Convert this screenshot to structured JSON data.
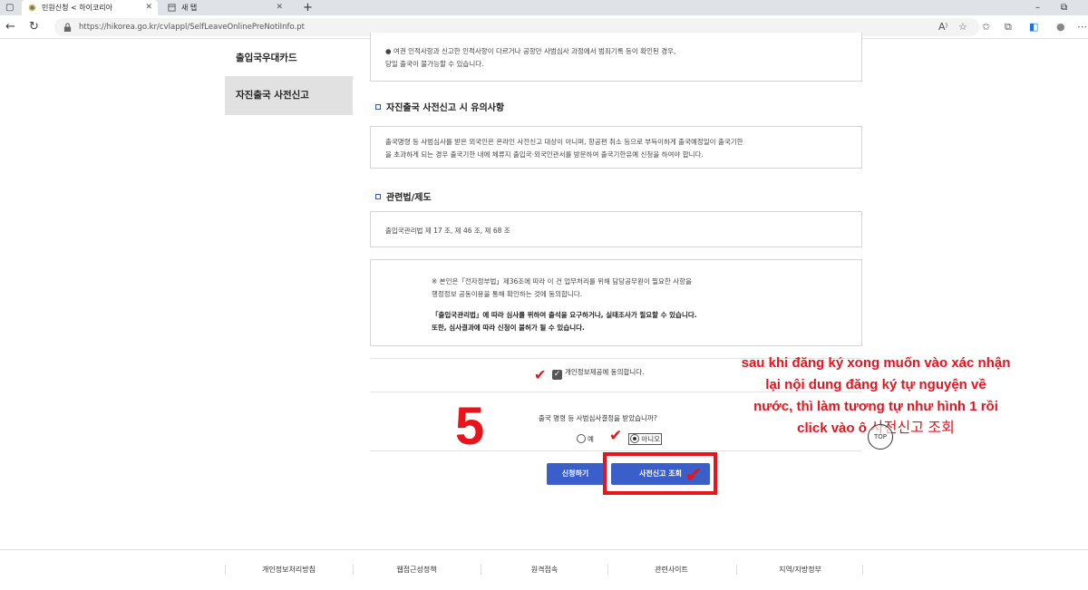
{
  "browser": {
    "tabs": [
      {
        "title": "민원신청 < 하이코리아"
      },
      {
        "title": "새 탭"
      }
    ],
    "url": "https://hikorea.go.kr/cvlappl/SelfLeaveOnlinePreNotiInfo.pt"
  },
  "sidebar": {
    "items": [
      {
        "label": "출입국우대카드"
      },
      {
        "label": "자진출국 사전신고"
      }
    ]
  },
  "notice_box": {
    "line1": "● 여권 인적사항과 신고한 인적사항이 다르거나 공항만 사범심사 과정에서 범죄기록 등이 확인된 경우,",
    "line2": "당일 출국이 불가능할 수 있습니다."
  },
  "precautions": {
    "title": "자진출국 사전신고 시 유의사항",
    "line1": "출국명령 등 사범심사를 받은 외국인은 온라인 사전신고 대상이 아니며, 항공편 취소 등으로 부득이하게 출국예정일이 출국기한",
    "line2": "을 초과하게 되는 경우 출국기한 내에 체류지 출입국·외국인관서를 방문하여 출국기한유예 신청을 하여야 합니다."
  },
  "laws": {
    "title": "관련법/제도",
    "text": "출입국관리법 제 17 조, 제 46 조, 제 68 조"
  },
  "agreement": {
    "line1": "※ 본인은「전자정부법」제36조에 따라 이 건 업무처리를 위해 담당공무원이 필요한 사항을",
    "line2": "행정정보 공동이용을 통해 확인하는 것에 동의합니다.",
    "line3": "「출입국관리법」에 따라 심사를 위하여 출석을 요구하거나, 실태조사가 필요할 수 있습니다.",
    "line4": "또한, 심사결과에 따라 신청이 불허가 될 수 있습니다."
  },
  "consent": {
    "label": "개인정보제공에 동의합니다.",
    "checked": true
  },
  "question": {
    "label": "출국 명령 등 사범심사결정을 받았습니까?",
    "yes": "예",
    "no": "아니오",
    "selected": "아니오"
  },
  "buttons": {
    "apply": "신청하기",
    "check": "사전신고 조회"
  },
  "annotation": {
    "number": "5",
    "line1": "sau khi đăng ký xong muốn vào xác nhận",
    "line2": "lại nội dung đăng ký tự nguyện về",
    "line3": "nước, thì làm tương tự như hình 1 rồi",
    "line4_prefix": "click vào ô",
    "line4_ko": "사전신고 조회",
    "color": "#e8131b"
  },
  "top_button": "TOP",
  "footer": {
    "items": [
      "개인정보처리방침",
      "웹접근성정책",
      "원격접속",
      "관련사이트",
      "지역/지방정부"
    ]
  }
}
